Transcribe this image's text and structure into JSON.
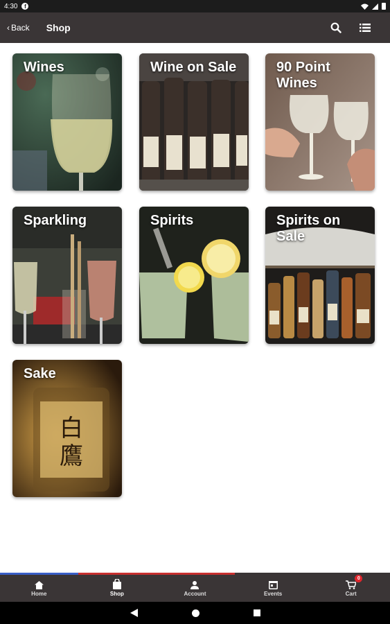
{
  "status_bar": {
    "time": "4:30",
    "notification_icon": "facebook-icon"
  },
  "header": {
    "back_label": "Back",
    "title": "Shop",
    "search_icon": "search-icon",
    "list_icon": "list-icon"
  },
  "categories": [
    {
      "label": "Wines"
    },
    {
      "label": "Wine on Sale"
    },
    {
      "label": "90 Point Wines"
    },
    {
      "label": "Sparkling"
    },
    {
      "label": "Spirits"
    },
    {
      "label": "Spirits on Sale"
    },
    {
      "label": "Sake"
    }
  ],
  "bottom_nav": {
    "items": [
      {
        "label": "Home",
        "icon": "home-icon"
      },
      {
        "label": "Shop",
        "icon": "shopping-bag-icon",
        "active": true
      },
      {
        "label": "Account",
        "icon": "person-icon"
      },
      {
        "label": "Events",
        "icon": "calendar-icon"
      },
      {
        "label": "Cart",
        "icon": "cart-icon",
        "badge": "0"
      }
    ],
    "accent_colors": [
      "#3a5fc8",
      "#c8d0e0",
      "#c8302f"
    ]
  },
  "colors": {
    "toolbar": "#3a3536",
    "status": "#1c1c1c",
    "badge": "#e0262d"
  }
}
